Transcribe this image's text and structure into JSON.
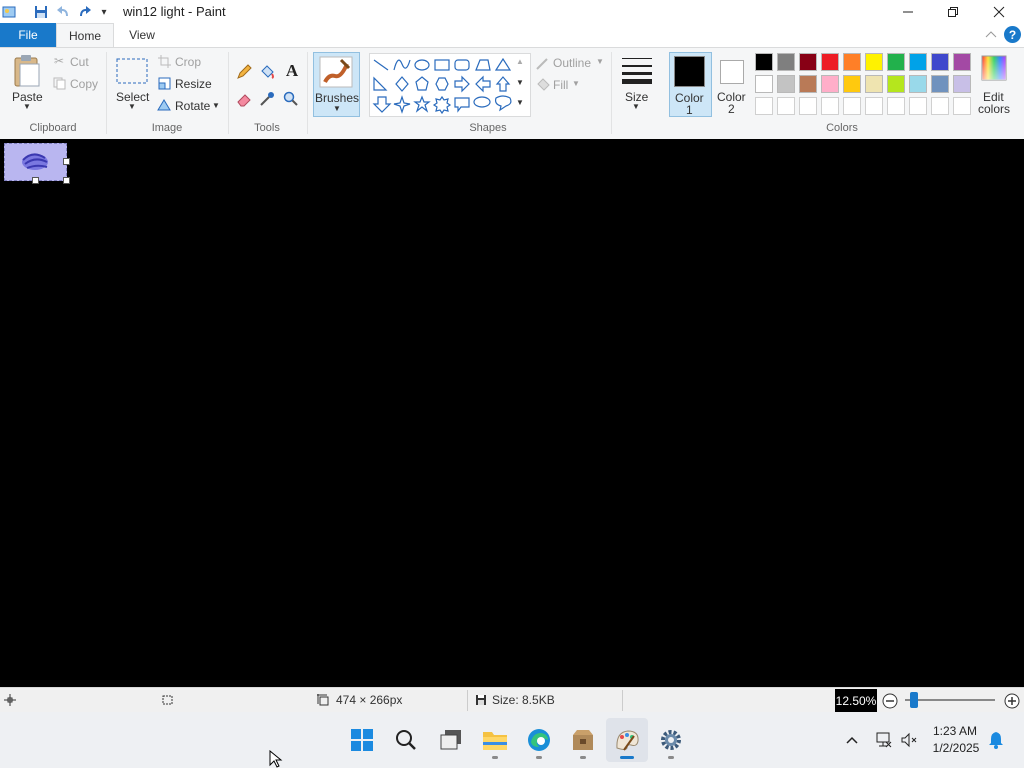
{
  "window": {
    "title": "win12 light - Paint"
  },
  "tabs": {
    "file": "File",
    "home": "Home",
    "view": "View"
  },
  "clipboard": {
    "paste": "Paste",
    "cut": "Cut",
    "copy": "Copy",
    "label": "Clipboard"
  },
  "image": {
    "select": "Select",
    "crop": "Crop",
    "resize": "Resize",
    "rotate": "Rotate",
    "label": "Image"
  },
  "tools": {
    "label": "Tools"
  },
  "brushes": {
    "label": "Brushes"
  },
  "shapes": {
    "outline": "Outline",
    "fill": "Fill",
    "label": "Shapes"
  },
  "size": {
    "label": "Size"
  },
  "colors": {
    "color1_line1": "Color",
    "color1_line2": "1",
    "color2_line1": "Color",
    "color2_line2": "2",
    "edit_line1": "Edit",
    "edit_line2": "colors",
    "label": "Colors",
    "color1": "#000000",
    "color2": "#ffffff",
    "row1": [
      "#000000",
      "#7f7f7f",
      "#880015",
      "#ed1c24",
      "#ff7f27",
      "#fff200",
      "#22b14c",
      "#00a2e8",
      "#3f48cc",
      "#a349a4"
    ],
    "row2": [
      "#ffffff",
      "#c3c3c3",
      "#b97a57",
      "#ffaec9",
      "#ffc90e",
      "#efe4b0",
      "#b5e61d",
      "#99d9ea",
      "#7092be",
      "#c8bfe7"
    ],
    "row3": [
      "#ffffff",
      "#ffffff",
      "#ffffff",
      "#ffffff",
      "#ffffff",
      "#ffffff",
      "#ffffff",
      "#ffffff",
      "#ffffff",
      "#ffffff"
    ]
  },
  "status": {
    "dimensions": "474 × 266px",
    "size": "Size: 8.5KB",
    "zoom": "12.50%",
    "zoom_level": 0.1
  },
  "taskbar": {
    "time": "1:23 AM",
    "date": "1/2/2025"
  }
}
